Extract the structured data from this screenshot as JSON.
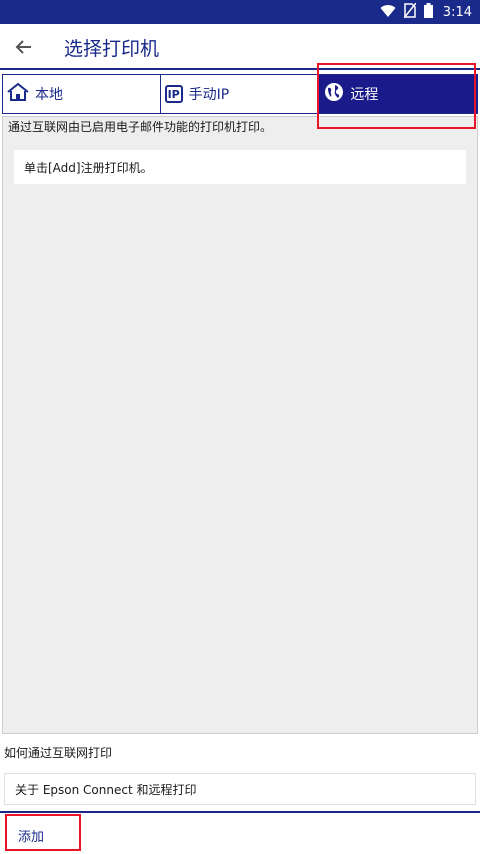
{
  "status_bar": {
    "time": "3:14"
  },
  "app_bar": {
    "title": "选择打印机"
  },
  "tabs": [
    {
      "label": "本地",
      "icon": "home-icon"
    },
    {
      "label": "手动IP",
      "icon": "ip-icon",
      "icon_text": "IP"
    },
    {
      "label": "远程",
      "icon": "globe-icon",
      "active": true
    }
  ],
  "main": {
    "description": "通过互联网由已启用电子邮件功能的打印机打印。",
    "register_prompt": "单击[Add]注册打印机。"
  },
  "help": {
    "heading": "如何通过互联网打印",
    "link": "关于 Epson Connect 和远程打印"
  },
  "footer": {
    "add_label": "添加"
  },
  "colors": {
    "brand": "#1a2a8a",
    "highlight": "#e8142a",
    "background": "#eeeeee"
  }
}
